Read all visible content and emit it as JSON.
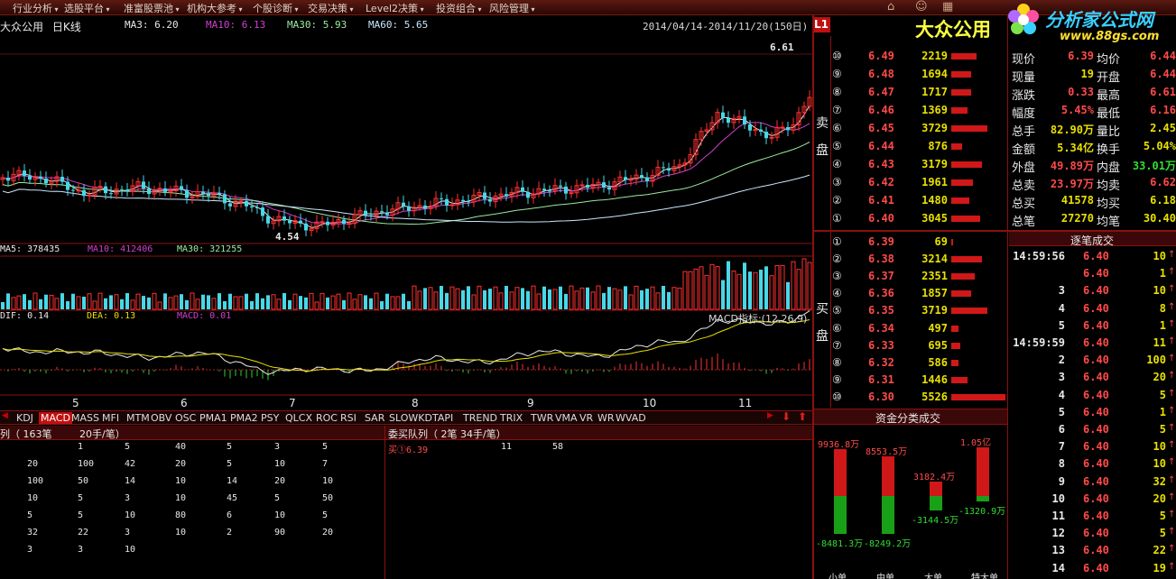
{
  "menu": [
    "行业分析",
    "选股平台",
    "准富股票池",
    "机构大参考",
    "个股诊断",
    "交易决策",
    "Level2决策",
    "投资组合",
    "风险管理"
  ],
  "header": {
    "stock": "大众公用",
    "period": "日K线",
    "ma3": "MA3: 6.20",
    "ma10": "MA10: 6.13",
    "ma30": "MA30: 5.93",
    "ma60": "MA60: 5.65",
    "range": "2014/04/14-2014/11/20(150日)",
    "l1": "L1"
  },
  "price_annot": {
    "high": "6.61",
    "low": "4.54"
  },
  "vol_header": {
    "ma5": "MA5: 378435",
    "ma10": "MA10: 412406",
    "ma30": "MA30: 321255"
  },
  "macd_header": {
    "dif": "DIF: 0.14",
    "dea": "DEA: 0.13",
    "macd": "MACD: 0.01",
    "title": "MACD指标:(12,26,9)"
  },
  "months": [
    "5",
    "6",
    "7",
    "8",
    "9",
    "10",
    "11"
  ],
  "tabs": [
    "KDJ",
    "MACD",
    "MASS",
    "MFI",
    "MTM",
    "OBV",
    "OSC",
    "PMA1",
    "PMA2",
    "PSY",
    "QLCX",
    "ROC",
    "RSI",
    "SAR",
    "SLOWKD",
    "TAPI",
    "TREND",
    "TRIX",
    "TWR",
    "VMA",
    "VR",
    "WR",
    "WVAD"
  ],
  "sell_queue_header": {
    "left": "列（  163笔",
    "mid": "20手/笔）"
  },
  "sell_queue_rows": [
    [
      "",
      "1",
      "5",
      "40",
      "5",
      "3",
      "5"
    ],
    [
      "20",
      "100",
      "42",
      "20",
      "5",
      "10",
      "7"
    ],
    [
      "100",
      "50",
      "14",
      "10",
      "14",
      "20",
      "10"
    ],
    [
      "10",
      "5",
      "3",
      "10",
      "45",
      "5",
      "50"
    ],
    [
      "5",
      "5",
      "10",
      "80",
      "6",
      "10",
      "5"
    ],
    [
      "32",
      "22",
      "3",
      "10",
      "2",
      "90",
      "20"
    ],
    [
      "3",
      "3",
      "10",
      "",
      "",
      "",
      ""
    ]
  ],
  "buy_queue": {
    "header": "委买队列（    2笔       34手/笔）",
    "row_label": "买①6.39",
    "v1": "11",
    "v2": "58"
  },
  "stock_name_big": "大众公用",
  "logo": {
    "text": "分析家公式网",
    "url": "www.88gs.com"
  },
  "side_labels": {
    "sell": [
      "卖",
      "盘"
    ],
    "buy": [
      "买",
      "盘"
    ]
  },
  "sell_levels": [
    {
      "n": "⑩",
      "p": "6.49",
      "v": "2219",
      "bar": 28
    },
    {
      "n": "⑨",
      "p": "6.48",
      "v": "1694",
      "bar": 22
    },
    {
      "n": "⑧",
      "p": "6.47",
      "v": "1717",
      "bar": 22
    },
    {
      "n": "⑦",
      "p": "6.46",
      "v": "1369",
      "bar": 18
    },
    {
      "n": "⑥",
      "p": "6.45",
      "v": "3729",
      "bar": 40
    },
    {
      "n": "⑤",
      "p": "6.44",
      "v": "876",
      "bar": 12
    },
    {
      "n": "④",
      "p": "6.43",
      "v": "3179",
      "bar": 34
    },
    {
      "n": "③",
      "p": "6.42",
      "v": "1961",
      "bar": 24
    },
    {
      "n": "②",
      "p": "6.41",
      "v": "1480",
      "bar": 20
    },
    {
      "n": "①",
      "p": "6.40",
      "v": "3045",
      "bar": 32
    }
  ],
  "buy_levels": [
    {
      "n": "①",
      "p": "6.39",
      "v": "69",
      "bar": 2
    },
    {
      "n": "②",
      "p": "6.38",
      "v": "3214",
      "bar": 34
    },
    {
      "n": "③",
      "p": "6.37",
      "v": "2351",
      "bar": 26
    },
    {
      "n": "④",
      "p": "6.36",
      "v": "1857",
      "bar": 22
    },
    {
      "n": "⑤",
      "p": "6.35",
      "v": "3719",
      "bar": 40
    },
    {
      "n": "⑥",
      "p": "6.34",
      "v": "497",
      "bar": 8
    },
    {
      "n": "⑦",
      "p": "6.33",
      "v": "695",
      "bar": 10
    },
    {
      "n": "⑧",
      "p": "6.32",
      "v": "586",
      "bar": 8
    },
    {
      "n": "⑨",
      "p": "6.31",
      "v": "1446",
      "bar": 18
    },
    {
      "n": "⑩",
      "p": "6.30",
      "v": "5526",
      "bar": 60
    }
  ],
  "capital_flow": {
    "title": "资金分类成交",
    "pos": [
      "9936.8万",
      "8553.5万",
      "3182.4万",
      "1.05亿"
    ],
    "neg": [
      "-8481.3万",
      "-8249.2万",
      "-3144.5万",
      "-1320.9万"
    ],
    "cats": [
      "小单",
      "中单",
      "大单",
      "特大单"
    ]
  },
  "quote": [
    [
      "现价",
      "6.39",
      "均价",
      "6.44"
    ],
    [
      "现量",
      "19",
      "开盘",
      "6.44"
    ],
    [
      "涨跌",
      "0.33",
      "最高",
      "6.61"
    ],
    [
      "幅度",
      "5.45%",
      "最低",
      "6.16"
    ],
    [
      "总手",
      "82.90万",
      "量比",
      "2.45"
    ],
    [
      "金额",
      "5.34亿",
      "换手",
      "5.04%"
    ],
    [
      "外盘",
      "49.89万",
      "内盘",
      "33.01万"
    ],
    [
      "总卖",
      "23.97万",
      "均卖",
      "6.62"
    ],
    [
      "总买",
      "41578",
      "均买",
      "6.18"
    ],
    [
      "总笔",
      "27270",
      "均笔",
      "30.40"
    ]
  ],
  "ticks_title": "逐笔成交",
  "ticks": [
    [
      "14:59:56",
      "6.40",
      "10"
    ],
    [
      "",
      "6.40",
      "1"
    ],
    [
      "3",
      "6.40",
      "10"
    ],
    [
      "4",
      "6.40",
      "8"
    ],
    [
      "5",
      "6.40",
      "1"
    ],
    [
      "14:59:59",
      "6.40",
      "11"
    ],
    [
      "2",
      "6.40",
      "100"
    ],
    [
      "3",
      "6.40",
      "20"
    ],
    [
      "4",
      "6.40",
      "5"
    ],
    [
      "5",
      "6.40",
      "1"
    ],
    [
      "6",
      "6.40",
      "5"
    ],
    [
      "7",
      "6.40",
      "10"
    ],
    [
      "8",
      "6.40",
      "10"
    ],
    [
      "9",
      "6.40",
      "32"
    ],
    [
      "10",
      "6.40",
      "20"
    ],
    [
      "11",
      "6.40",
      "5"
    ],
    [
      "12",
      "6.40",
      "5"
    ],
    [
      "13",
      "6.40",
      "22"
    ],
    [
      "14",
      "6.40",
      "19"
    ]
  ]
}
